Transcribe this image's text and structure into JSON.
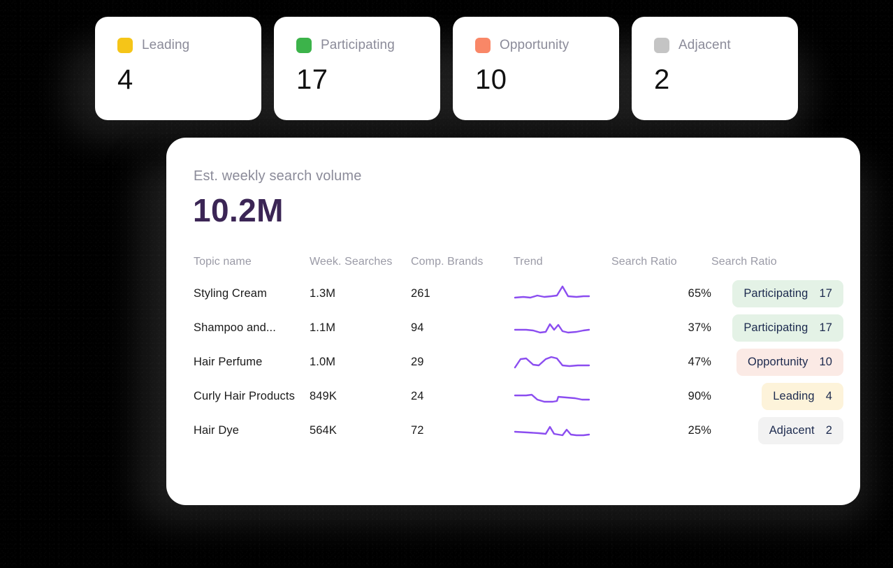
{
  "theme": {
    "page_background": "#000000",
    "card_background": "#ffffff",
    "metric_color": "#3b2555",
    "muted_text": "#8b8b99",
    "trend_line_color": "#8b4df0"
  },
  "stats": {
    "cards": [
      {
        "label": "Leading",
        "value": "4",
        "color": "#f5c518",
        "swatch_name": "leading-swatch"
      },
      {
        "label": "Participating",
        "value": "17",
        "color": "#3cb34a",
        "swatch_name": "participating-swatch"
      },
      {
        "label": "Opportunity",
        "value": "10",
        "color": "#f98767",
        "swatch_name": "opportunity-swatch"
      },
      {
        "label": "Adjacent",
        "value": "2",
        "color": "#c4c4c4",
        "swatch_name": "adjacent-swatch"
      }
    ]
  },
  "panel": {
    "subtitle": "Est. weekly search volume",
    "metric": "10.2M"
  },
  "table": {
    "headers": {
      "topic": "Topic name",
      "weekly": "Week. Searches",
      "brands": "Comp. Brands",
      "trend": "Trend",
      "ratio": "Search Ratio",
      "status": "Search Ratio"
    },
    "rows": [
      {
        "topic": "Styling Cream",
        "weekly": "1.3M",
        "brands": "261",
        "ratio": "65%",
        "badge_label": "Participating",
        "badge_count": "17",
        "badge_bg": "#e4f2e6",
        "spark": "2,20 14,19 24,20 34,17 44,19 54,18 62,17 70,4 78,18 90,19 100,18 108,18"
      },
      {
        "topic": "Shampoo and...",
        "weekly": "1.1M",
        "brands": "94",
        "ratio": "37%",
        "badge_label": "Participating",
        "badge_count": "17",
        "badge_bg": "#e4f2e6",
        "spark": "2,17 18,17 28,18 38,21 46,20 52,9 58,17 64,10 70,19 78,21 90,20 100,18 108,17"
      },
      {
        "topic": "Hair Perfume",
        "weekly": "1.0M",
        "brands": "29",
        "ratio": "47%",
        "badge_label": "Opportunity",
        "badge_count": "10",
        "badge_bg": "#fbeae5",
        "spark": "2,22 10,10 18,9 28,18 36,19 46,10 54,7 62,9 70,19 80,20 92,19 100,19 108,19"
      },
      {
        "topic": "Curly Hair Products",
        "weekly": "849K",
        "brands": "24",
        "ratio": "90%",
        "badge_label": "Leading",
        "badge_count": "4",
        "badge_bg": "#fdf3da",
        "spark": "2,13 18,13 26,12 34,19 44,22 56,22 62,21 64,15 76,16 88,17 98,19 108,19"
      },
      {
        "topic": "Hair Dye",
        "weekly": "564K",
        "brands": "72",
        "ratio": "25%",
        "badge_label": "Adjacent",
        "badge_count": "2",
        "badge_bg": "#f2f2f2",
        "spark": "2,16 20,17 36,18 46,19 52,9 58,19 64,20 70,21 76,13 82,20 90,21 100,21 108,20"
      }
    ]
  }
}
